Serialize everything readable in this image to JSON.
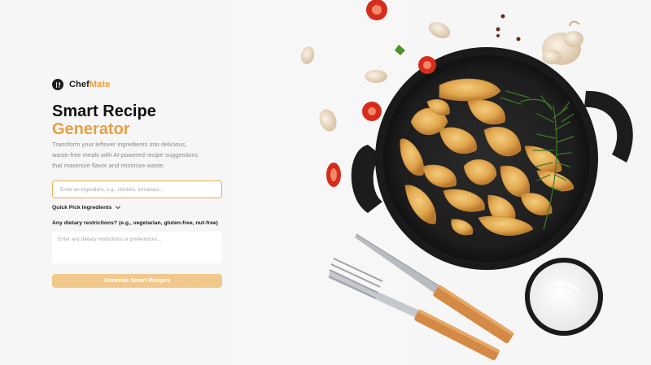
{
  "app": {
    "brand_part1": "Chef",
    "brand_part2": "Mate",
    "accent_color": "#e8a040",
    "brand_icon": "fork-knife-icon"
  },
  "hero": {
    "headline_line1": "Smart Recipe",
    "headline_line2": "Generator",
    "description": "Transform your leftover ingredients into delicious, waste-free meals with AI-powered recipe suggestions that maximize flavor and minimize waste."
  },
  "form": {
    "ingredient_placeholder": "Enter an ingredient, e.g., chicken, tomatoes...",
    "ingredient_value": "",
    "quick_pick_label": "Quick Pick Ingredients",
    "dietary_label": "Any dietary restrictions? (e.g., vegetarian, gluten-free, nut-free)",
    "dietary_placeholder": "Enter any dietary restrictions or preferences...",
    "dietary_value": "",
    "generate_label": "Generate Smart Recipes",
    "button_color": "#f1c88b"
  },
  "image": {
    "subject": "food-photo-roasted-potatoes-in-pan"
  }
}
